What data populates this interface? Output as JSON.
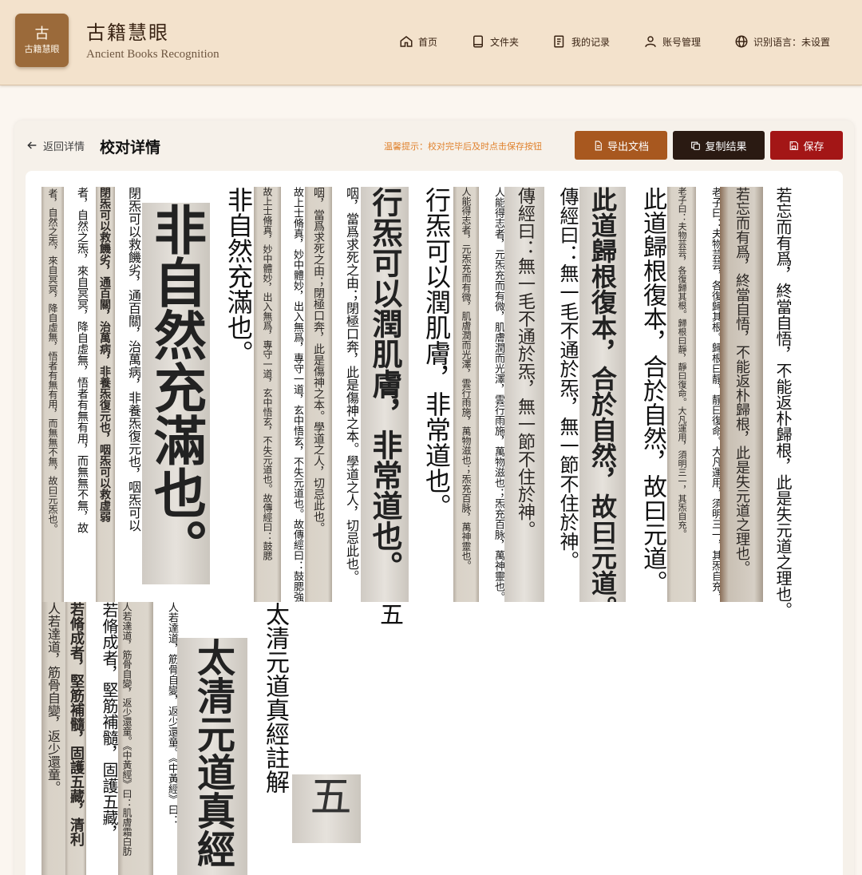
{
  "app": {
    "logo_glyph": "古",
    "logo_text": "古籍慧眼",
    "title": "古籍慧眼",
    "subtitle": "Ancient Books Recognition"
  },
  "nav": {
    "home": "首页",
    "folder": "文件夹",
    "records": "我的记录",
    "account": "账号管理",
    "language": "识别语言：未设置"
  },
  "toolbar": {
    "back": "返回详情",
    "title": "校对详情",
    "tip": "温馨提示：校对完毕后及时点击保存按钮",
    "export": "导出文档",
    "copy": "复制结果",
    "save": "保存"
  },
  "colors": {
    "header_bg": "#f3e2cc",
    "export_btn": "#a8581f",
    "copy_btn": "#2a1a12",
    "save_btn": "#a31616",
    "tip": "#e0822e"
  },
  "columns": {
    "c1": "者，自然之炁，來自冥冥，降自虛無，悟者有無有用，而無無不無，故曰元炁也。",
    "c2": "者，自然之炁，來自冥冥，降自虛無，悟者有無有用，而無無不無，故",
    "c3": "閉炁可以救饑劣，通百關，治萬病，非養炁復元也，咽炁可以救虛弱",
    "c4": "閉炁可以救饑劣，通百關，治萬病，非養炁復元也，咽炁可以",
    "c5": "非自然充滿也。",
    "c6": "非自然充滿也。",
    "c7": "故上士脩真，妙中體妙，出入無爲，專守一道，玄中悟玄，不失元道也。故傳經曰：鼓腮",
    "c8": "故上士脩真，妙中體妙，出入無爲，專守一道，玄中悟玄，不失元道也。故傳經曰：鼓腮強",
    "c9": "咽，當爲求死之由；閉極口奔，此是傷神之本。學道之人，切忌此也。",
    "c10": "咽，當爲求死之由；閉極口奔，此是傷神之本。學道之人，切忌此也。",
    "c11": "行炁可以潤肌膚，非常道也。",
    "c11b": "五",
    "c12": "行炁可以潤肌膚，非常道也。",
    "c13": "人能得志者，元炁充而有微，肌膚潤而光澤，雲行雨施，萬物滋也；炁充百脉，萬神靈也。",
    "c14": "人能得志者，元炁充而有微，肌膚潤而光澤，雲行雨施，萬物滋也；炁充百脉，萬神靈也。",
    "c15": "傳經曰：無一毛不通於炁，無一節不住於神。",
    "c16": "傳經曰：無一毛不通於炁，無一節不住於神。",
    "c17": "此道歸根復本，合於自然，故曰元道。",
    "c18": "此道歸根復本，合於自然，故曰元道。",
    "c19": "老子曰：夫物芸芸，各復歸其根。歸根曰靜，靜曰復命。大凡運用，須明三一，其炁自充。",
    "c20": "老子曰：夫物芸芸，各復歸其根。歸根曰靜，靜曰復命。大凡運用，須明三一，其炁自充，",
    "c21": "若忘而有爲，終當自悟，不能返朴歸根，此是失元道之理也。",
    "c22": "若忘而有爲，終當自悟，不能返朴歸根，此是失元道之理也。",
    "r2c1": "人若達道，筋骨自變，返少還童。",
    "r2c2": "若脩成者，堅筋補髓，固護五藏，清利",
    "r2c3": "若脩成者，堅筋補髓，固護五藏，",
    "r2c4": "人若達道，筋骨自變，返少還童。《中黃經》曰：肌膚霜白肪",
    "r2c5": "人若達道，筋骨自變，返少還童。《中黃經》曰：",
    "r2c6": "太清元道真經",
    "r2c7": "太清元道真經註解",
    "r2c8": "五"
  }
}
